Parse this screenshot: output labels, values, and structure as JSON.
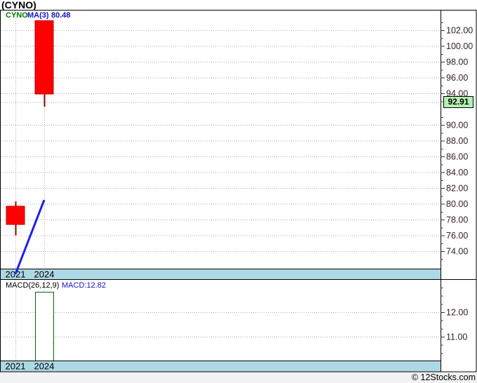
{
  "title": "(CYNO)",
  "main": {
    "legend": {
      "symbol": "CYNO",
      "ma_label": "MA(3)",
      "ma_value": "80.48"
    },
    "current_price_label": "92.91"
  },
  "macd": {
    "params_label": "MACD(26,12,9)",
    "value_label": "MACD:12.82"
  },
  "footer": {
    "watermark": "© 12Stocks.com"
  },
  "colors": {
    "candle_fill": "#fe0000",
    "candle_border": "#c00000",
    "wick": "#900000",
    "ma_line": "#2020e8",
    "macd_bar_fill": "#ffffff",
    "macd_bar_border": "#006400",
    "band_fill": "#add8e6",
    "price_tag_bg": "#b4f0b4",
    "grid": "#aaaaaa",
    "axis_text": "#332222",
    "legend_symbol": "#007800",
    "legend_blue": "#1212cc"
  },
  "chart_data": [
    {
      "type": "candlestick",
      "title": "CYNO",
      "legend": [
        "CYNO",
        "MA(3)",
        "80.48"
      ],
      "x_categories": [
        "2021",
        "2024"
      ],
      "candles": [
        {
          "x": "2021",
          "open": 79.7,
          "high": 80.3,
          "low": 76.0,
          "close": 77.4,
          "direction": "down"
        },
        {
          "x": "2024",
          "open": 103.2,
          "high": 103.2,
          "low": 92.3,
          "close": 93.9,
          "direction": "down"
        }
      ],
      "ma_line": {
        "name": "MA(3)",
        "last_value": 80.48,
        "points": [
          {
            "x": "2021",
            "value": 71.1
          },
          {
            "x": "2024",
            "value": 80.48
          }
        ]
      },
      "current_price": 92.91,
      "y_axis": {
        "min": 71.8,
        "max": 104.6,
        "tick_step": 2,
        "label_ticks": [
          102,
          100,
          98,
          96,
          94,
          90,
          88,
          86,
          84,
          82,
          80,
          78,
          76,
          74
        ],
        "label_format": "0.00",
        "side": "right"
      },
      "grid": true,
      "legend_position": "top-left"
    },
    {
      "type": "bar",
      "title": "MACD(26,12,9)",
      "value_label": "MACD:12.82",
      "x_categories": [
        "2021",
        "2024"
      ],
      "values": [
        null,
        12.82
      ],
      "y_axis": {
        "min": 10.0,
        "max": 13.3,
        "label_ticks": [
          12,
          11
        ],
        "label_format": "0.00",
        "side": "right"
      },
      "grid": true
    }
  ]
}
